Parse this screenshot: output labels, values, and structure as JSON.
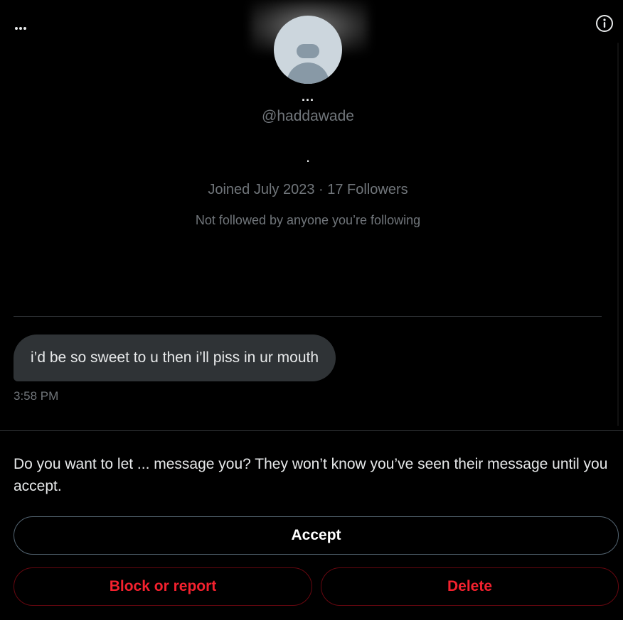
{
  "header": {
    "more_icon": "ellipsis-icon",
    "info_icon": "info-circle-icon"
  },
  "profile": {
    "display_name": "...",
    "handle": "@haddawade",
    "bio": ".",
    "joined": "Joined July 2023",
    "separator": "·",
    "followers": "17 Followers",
    "not_followed": "Not followed by anyone you’re following"
  },
  "conversation": {
    "messages": [
      {
        "text": "i’d be so sweet to u then i’ll piss in ur mouth",
        "time": "3:58 PM"
      }
    ]
  },
  "request": {
    "prompt": "Do you want to let ... message you? They won’t know you’ve seen their message until you accept.",
    "accept_label": "Accept",
    "block_label": "Block or report",
    "delete_label": "Delete"
  },
  "colors": {
    "background": "#000000",
    "text": "#e7e9ea",
    "secondary_text": "#71767b",
    "bubble": "#2f3336",
    "danger": "#f4212e",
    "border": "#536471"
  }
}
